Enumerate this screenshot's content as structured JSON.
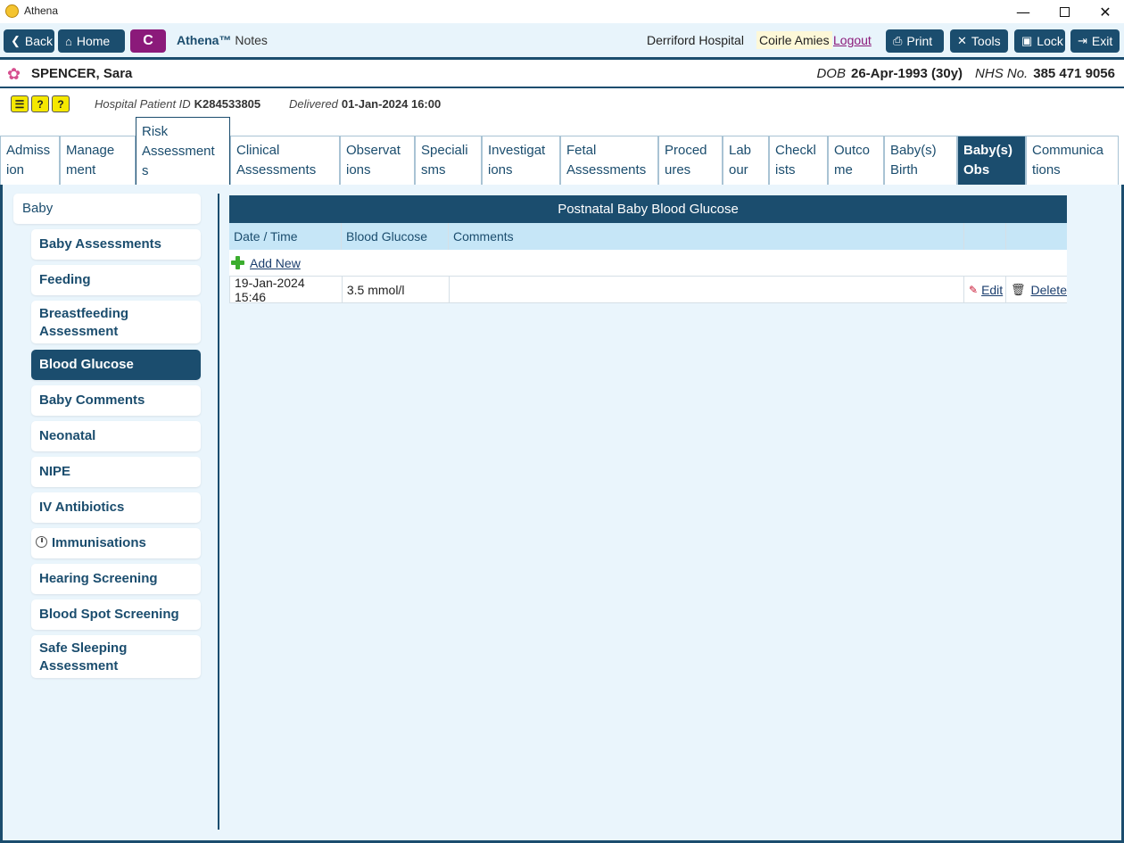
{
  "window": {
    "title": "Athena",
    "controls": {
      "minimize": "—",
      "close": "✕"
    }
  },
  "toolbar": {
    "back_label": "Back",
    "home_label": "Home",
    "c_label": "C",
    "brand": "Athena™",
    "brand_suffix": "Notes",
    "hospital": "Derriford Hospital",
    "user": "Coirle Amies",
    "logout_label": "Logout",
    "print_label": "Print",
    "tools_label": "Tools",
    "lock_label": "Lock",
    "exit_label": "Exit"
  },
  "patient": {
    "name": "SPENCER, Sara",
    "dob_label": "DOB",
    "dob": "26-Apr-1993 (30y)",
    "nhs_label": "NHS No.",
    "nhs": "385 471 9056",
    "hospital_id_label": "Hospital Patient ID",
    "hospital_id": "K284533805",
    "delivered_label": "Delivered",
    "delivered": "01-Jan-2024 16:00",
    "alerts": [
      "?",
      "?"
    ]
  },
  "tabs": [
    {
      "line1": "Admiss",
      "line2": "ion"
    },
    {
      "line1": "Manage",
      "line2": "ment"
    },
    {
      "line1": "Risk",
      "line2": "Assessment",
      "line3": "s"
    },
    {
      "line1": "Clinical",
      "line2": "Assessments"
    },
    {
      "line1": "Observat",
      "line2": "ions"
    },
    {
      "line1": "Speciali",
      "line2": "sms"
    },
    {
      "line1": "Investigat",
      "line2": "ions"
    },
    {
      "line1": "Fetal",
      "line2": "Assessments"
    },
    {
      "line1": "Proced",
      "line2": "ures"
    },
    {
      "line1": "Lab",
      "line2": "our"
    },
    {
      "line1": "Checkl",
      "line2": "ists"
    },
    {
      "line1": "Outco",
      "line2": "me"
    },
    {
      "line1": "Baby(s)",
      "line2": "Birth"
    },
    {
      "line1": "Baby(s)",
      "line2": "Obs"
    },
    {
      "line1": "Communica",
      "line2": "tions"
    }
  ],
  "sidebar": {
    "parent": "Baby",
    "items": [
      {
        "label": "Baby Assessments"
      },
      {
        "label": "Feeding"
      },
      {
        "label": "Breastfeeding Assessment"
      },
      {
        "label": "Blood Glucose"
      },
      {
        "label": "Baby Comments"
      },
      {
        "label": "Neonatal"
      },
      {
        "label": "NIPE"
      },
      {
        "label": "IV Antibiotics"
      },
      {
        "label": "Immunisations"
      },
      {
        "label": "Hearing Screening"
      },
      {
        "label": "Blood Spot Screening"
      },
      {
        "label": "Safe Sleeping Assessment"
      }
    ]
  },
  "grid": {
    "title": "Postnatal Baby Blood Glucose",
    "columns": [
      "Date / Time",
      "Blood Glucose",
      "Comments"
    ],
    "add_label": "Add New",
    "rows": [
      {
        "datetime": "19-Jan-2024 15:46",
        "glucose": "3.5 mmol/l",
        "comments": "",
        "edit": "Edit",
        "delete": "Delete"
      }
    ]
  },
  "colors": {
    "primary": "#1b4d6e",
    "accent_c": "#8b1a7a",
    "content_bg": "#eaf5fc",
    "header_bg": "#c6e6f7"
  }
}
